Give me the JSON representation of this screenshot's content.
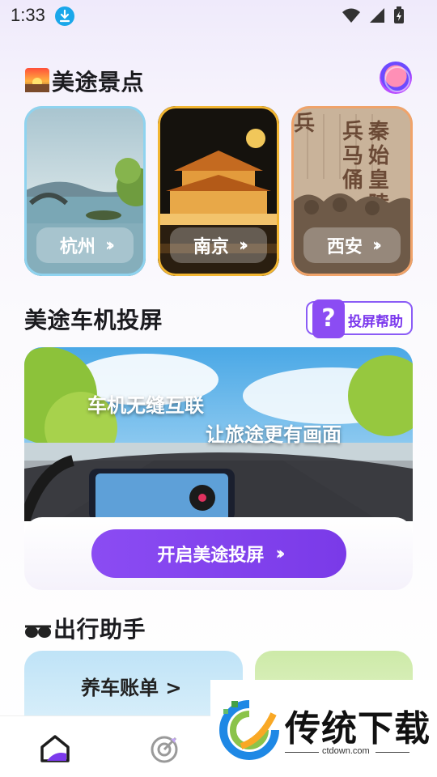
{
  "status_bar": {
    "time": "1:33"
  },
  "attractions": {
    "title": "美途景点",
    "cards": [
      {
        "label": "杭州",
        "accent": "#8fd3ef"
      },
      {
        "label": "南京",
        "accent": "#f2b632"
      },
      {
        "label": "西安",
        "accent": "#f0a36a"
      }
    ]
  },
  "projection": {
    "title": "美途车机投屏",
    "help_label": "投屏帮助",
    "help_icon": "?",
    "banner_line1": "车机无缝互联",
    "banner_line2": "让旅途更有画面",
    "button_label": "开启美途投屏"
  },
  "helper": {
    "title": "出行助手",
    "cards": [
      {
        "label": "养车账单 >"
      }
    ]
  },
  "watermark": {
    "text": "传统下载",
    "url": "ctdown.com"
  },
  "colors": {
    "primary": "#8b4cf3",
    "help_border": "#8b5cf6"
  }
}
